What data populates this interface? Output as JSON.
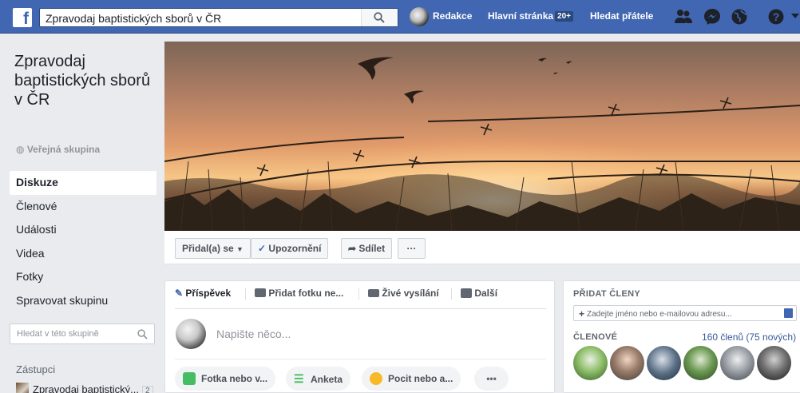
{
  "topbar": {
    "search_value": "Zpravodaj baptistických sborů v ČR",
    "profile_name": "Redakce",
    "home_label": "Hlavní stránka",
    "home_badge": "20+",
    "find_friends": "Hledat přátele"
  },
  "group": {
    "name": "Zpravodaj baptistických sborů v ČR",
    "privacy": "Veřejná skupina"
  },
  "sidebar": {
    "items": [
      {
        "label": "Diskuze"
      },
      {
        "label": "Členové"
      },
      {
        "label": "Události"
      },
      {
        "label": "Videa"
      },
      {
        "label": "Fotky"
      },
      {
        "label": "Spravovat skupinu"
      }
    ],
    "search_placeholder": "Hledat v této skupině",
    "representatives_heading": "Zástupci",
    "representative_name": "Zpravodaj baptistický...",
    "representative_count": "2"
  },
  "actions": {
    "joined": "Přidal(a) se",
    "notifications": "Upozornění",
    "share": "Sdílet",
    "more": "···"
  },
  "composer": {
    "tabs": [
      "Příspěvek",
      "Přidat fotku ne...",
      "Živé vysílání",
      "Další"
    ],
    "placeholder": "Napište něco...",
    "pills": [
      "Fotka nebo v...",
      "Anketa",
      "Pocit nebo a...",
      "•••"
    ]
  },
  "right": {
    "add_members_heading": "PŘIDAT ČLENY",
    "add_members_placeholder": "Zadejte jméno nebo e-mailovou adresu...",
    "members_heading": "ČLENOVÉ",
    "members_count": "160 členů (75 nových)"
  },
  "colors": {
    "brand": "#4267b2",
    "link": "#365899",
    "bg": "#e9ebee"
  }
}
